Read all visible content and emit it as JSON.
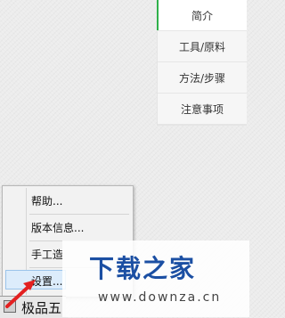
{
  "nav": {
    "items": [
      {
        "label": "简介",
        "active": true
      },
      {
        "label": "工具/原料",
        "active": false
      },
      {
        "label": "方法/步骤",
        "active": false
      },
      {
        "label": "注意事项",
        "active": false
      }
    ]
  },
  "context_menu": {
    "items": [
      "帮助...",
      "版本信息...",
      "手工造",
      "设置..."
    ]
  },
  "taskbar": {
    "label": "极品五",
    "icon": "app-icon"
  },
  "annotation": {
    "arrow_color": "#e32020",
    "icon": "pointer-arrow-icon"
  },
  "watermark": {
    "logo": "下载之家",
    "url": "www.downza.cn",
    "color": "#1b4fa3"
  }
}
